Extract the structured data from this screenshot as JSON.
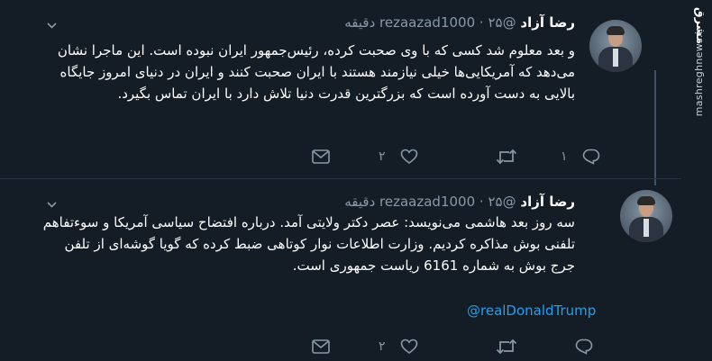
{
  "watermark": {
    "logo": "مشرق",
    "site": "mashreghnews.ir"
  },
  "tweets": [
    {
      "name": "رضا آزاد",
      "handle": "@rezaazad1000",
      "dot": "·",
      "time": "۲۵ دقیقه",
      "text": "و بعد معلوم شد کسی که با وی صحبت کرده، رئیس‌جمهور ایران نبوده است. این ماجرا نشان می‌دهد که آمریکایی‌ها خیلی نیازمند هستند با ایران صحبت کنند و ایران در دنیای امروز جایگاه بالایی به دست آورده است که بزرگترین قدرت دنیا تلاش دارد با ایران تماس بگیرد.",
      "reply_count": "۱",
      "retweet_count": "",
      "like_count": "۲"
    },
    {
      "name": "رضا آزاد",
      "handle": "@rezaazad1000",
      "dot": "·",
      "time": "۲۵ دقیقه",
      "text": "سه روز بعد هاشمی می‌نویسد: عصر دکتر ولایتی آمد. درباره افتضاح سیاسی آمریکا و سوءتفاهم تلفنی بوش مذاکره کردیم. وزارت اطلاعات نوار کوتاهی ضبط کرده که گویا گوشه‌ای از تلفن جرج بوش به شماره 6161 ریاست جمهوری است.",
      "mention": "@realDonaldTrump",
      "reply_count": "",
      "retweet_count": "",
      "like_count": "۲"
    }
  ],
  "icons": {
    "reply": "reply-icon",
    "retweet": "retweet-icon",
    "like": "heart-icon",
    "message": "envelope-icon",
    "menu": "chevron-down-icon"
  }
}
